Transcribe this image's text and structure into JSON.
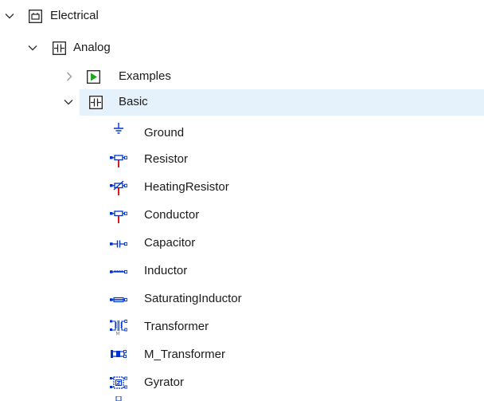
{
  "tree": {
    "electrical": {
      "label": "Electrical",
      "expanded": true
    },
    "analog": {
      "label": "Analog",
      "expanded": true
    },
    "examples": {
      "label": "Examples",
      "expanded": false
    },
    "basic": {
      "label": "Basic",
      "expanded": true,
      "selected": true
    },
    "basic_children": [
      {
        "label": "Ground",
        "icon": "ground-icon"
      },
      {
        "label": "Resistor",
        "icon": "resistor-icon"
      },
      {
        "label": "HeatingResistor",
        "icon": "heating-resistor-icon"
      },
      {
        "label": "Conductor",
        "icon": "conductor-icon"
      },
      {
        "label": "Capacitor",
        "icon": "capacitor-icon"
      },
      {
        "label": "Inductor",
        "icon": "inductor-icon"
      },
      {
        "label": "SaturatingInductor",
        "icon": "saturating-inductor-icon"
      },
      {
        "label": "Transformer",
        "icon": "transformer-icon"
      },
      {
        "label": "M_Transformer",
        "icon": "m-transformer-icon"
      },
      {
        "label": "Gyrator",
        "icon": "gyrator-icon"
      }
    ]
  },
  "colors": {
    "selection": "#e5f1fb",
    "wire_blue": "#0033cc",
    "pin_red": "#d40000",
    "examples_green": "#1fa81f"
  }
}
